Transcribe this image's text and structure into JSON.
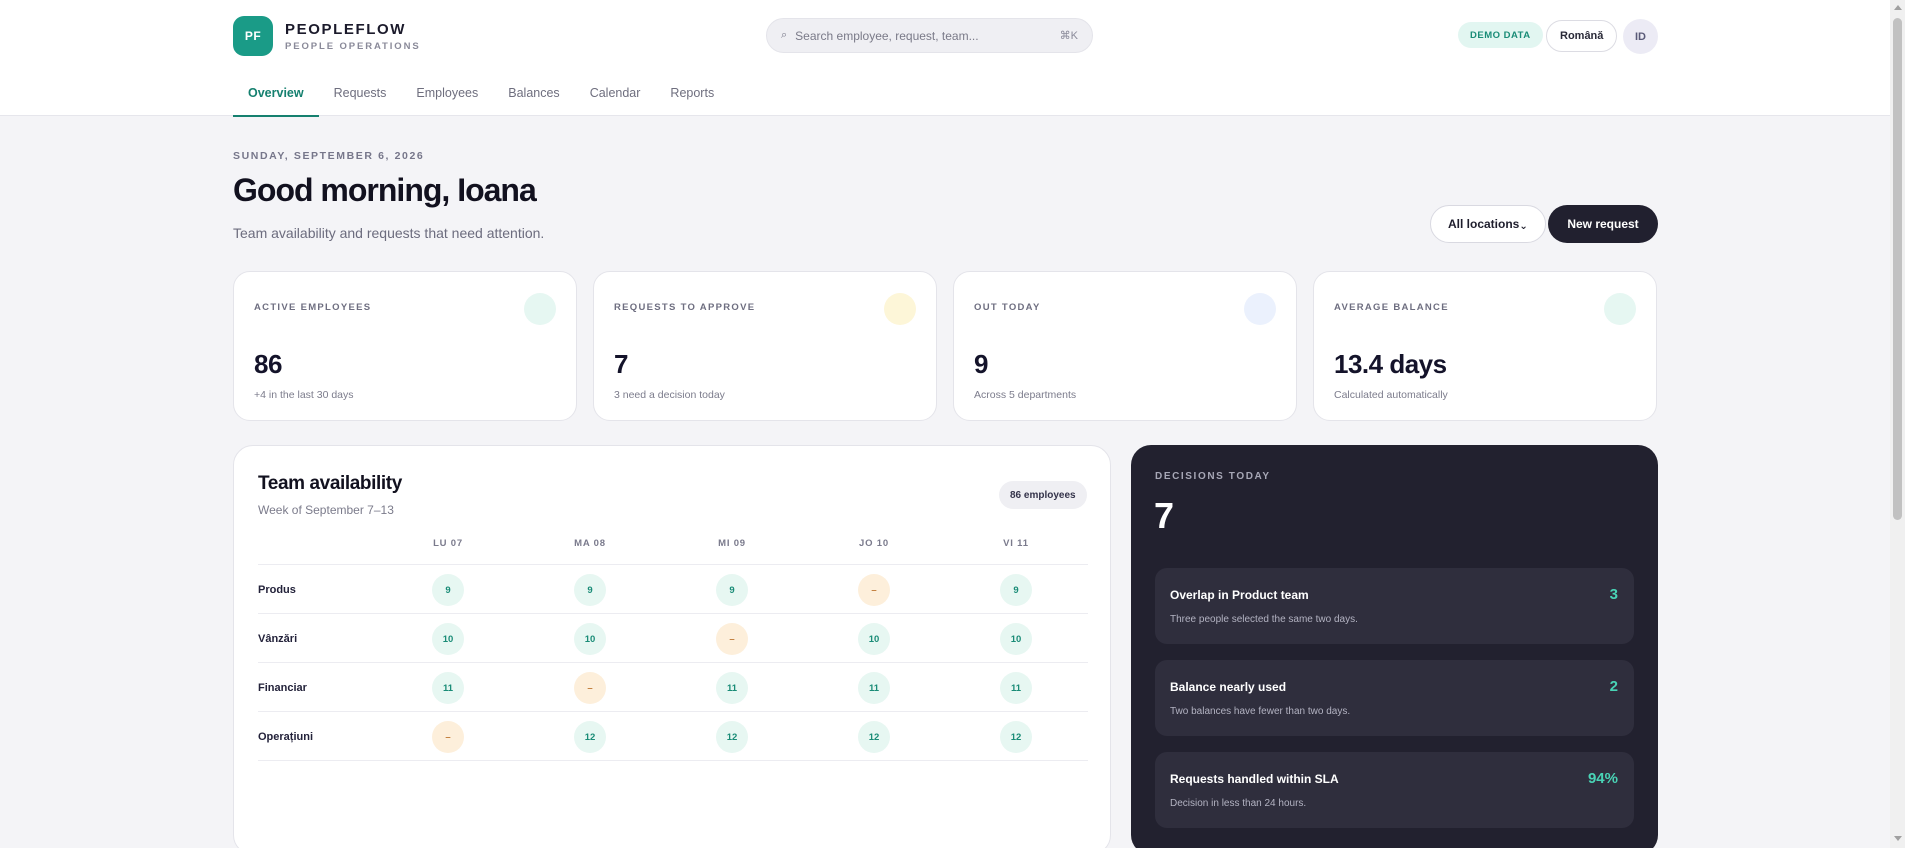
{
  "brand": {
    "logo": "PF",
    "name": "PEOPLEFLOW",
    "subtitle": "PEOPLE OPERATIONS"
  },
  "search": {
    "placeholder": "Search employee, request, team...",
    "shortcut": "⌘K",
    "icon": "search-icon"
  },
  "header": {
    "demo_badge": "DEMO DATA",
    "language": "Română",
    "avatar_initials": "ID"
  },
  "tabs": [
    {
      "label": "Overview",
      "active": true
    },
    {
      "label": "Requests",
      "active": false
    },
    {
      "label": "Employees",
      "active": false
    },
    {
      "label": "Balances",
      "active": false
    },
    {
      "label": "Calendar",
      "active": false
    },
    {
      "label": "Reports",
      "active": false
    }
  ],
  "page": {
    "date": "SUNDAY, SEPTEMBER 6, 2026",
    "greeting": "Good morning, Ioana",
    "subtitle": "Team availability and requests that need attention.",
    "location_filter": "All locations",
    "location_caret": "⌄",
    "new_request": "New request"
  },
  "stats": [
    {
      "label": "ACTIVE EMPLOYEES",
      "value": "86",
      "note": "+4 in the last 30 days",
      "dot_color": "#e6f7f2"
    },
    {
      "label": "REQUESTS TO APPROVE",
      "value": "7",
      "note": "3 need a decision today",
      "dot_color": "#fdf6d8"
    },
    {
      "label": "OUT TODAY",
      "value": "9",
      "note": "Across 5 departments",
      "dot_color": "#ebf1fd"
    },
    {
      "label": "AVERAGE BALANCE",
      "value": "13.4 days",
      "note": "Calculated automatically",
      "dot_color": "#e6f7f2"
    }
  ],
  "availability": {
    "title": "Team availability",
    "subtitle": "Week of September 7–13",
    "badge": "86 employees",
    "days": [
      "LU 07",
      "MA 08",
      "MI 09",
      "JO 10",
      "VI 11"
    ],
    "rows": [
      {
        "team": "Produs",
        "cells": [
          {
            "value": "9",
            "status": "ok"
          },
          {
            "value": "9",
            "status": "ok"
          },
          {
            "value": "9",
            "status": "ok"
          },
          {
            "value": "–",
            "status": "away"
          },
          {
            "value": "9",
            "status": "ok"
          }
        ]
      },
      {
        "team": "Vânzări",
        "cells": [
          {
            "value": "10",
            "status": "ok"
          },
          {
            "value": "10",
            "status": "ok"
          },
          {
            "value": "–",
            "status": "away"
          },
          {
            "value": "10",
            "status": "ok"
          },
          {
            "value": "10",
            "status": "ok"
          }
        ]
      },
      {
        "team": "Financiar",
        "cells": [
          {
            "value": "11",
            "status": "ok"
          },
          {
            "value": "–",
            "status": "away"
          },
          {
            "value": "11",
            "status": "ok"
          },
          {
            "value": "11",
            "status": "ok"
          },
          {
            "value": "11",
            "status": "ok"
          }
        ]
      },
      {
        "team": "Operațiuni",
        "cells": [
          {
            "value": "–",
            "status": "away"
          },
          {
            "value": "12",
            "status": "ok"
          },
          {
            "value": "12",
            "status": "ok"
          },
          {
            "value": "12",
            "status": "ok"
          },
          {
            "value": "12",
            "status": "ok"
          }
        ]
      }
    ]
  },
  "decisions": {
    "label": "DECISIONS TODAY",
    "count": "7",
    "items": [
      {
        "title": "Overlap in Product team",
        "description": "Three people selected the same two days.",
        "value": "3"
      },
      {
        "title": "Balance nearly used",
        "description": "Two balances have fewer than two days.",
        "value": "2"
      },
      {
        "title": "Requests handled within SLA",
        "description": "Decision in less than 24 hours.",
        "value": "94%"
      }
    ]
  },
  "colors": {
    "accent": "#15806f",
    "dark_panel": "#22212f",
    "highlight": "#49d3b5"
  }
}
